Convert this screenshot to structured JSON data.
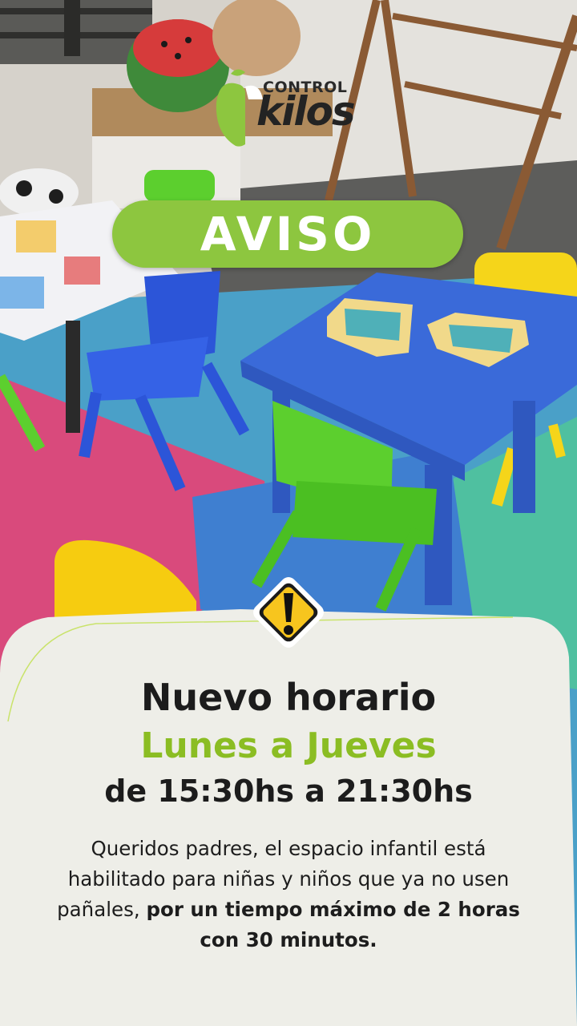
{
  "brand": {
    "control": "CONTROL",
    "kilos": "kilos",
    "accent_color": "#8dc63f"
  },
  "badge": {
    "label": "AVISO"
  },
  "notice": {
    "title": "Nuevo horario",
    "days": "Lunes a Jueves",
    "hours": "de 15:30hs a 21:30hs",
    "message_part1": "Queridos padres, el espacio infantil está habilitado para niñas y niños que ya no usen pañales,",
    "message_part2": "por un tiempo máximo de 2 horas con 30 minutos."
  },
  "icons": {
    "warning": "warning-sign-icon",
    "apple": "apple-logo-icon"
  }
}
